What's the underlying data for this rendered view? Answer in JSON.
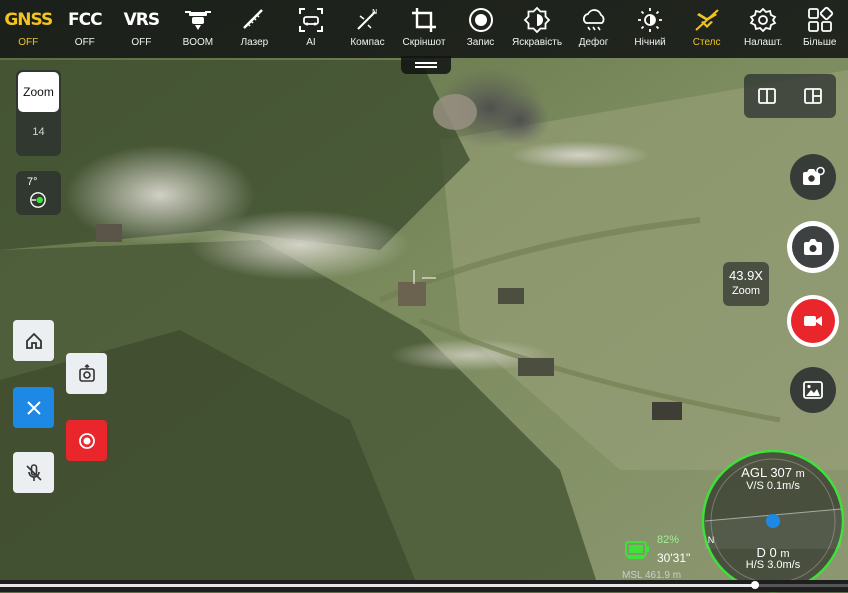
{
  "toolbar": {
    "items": [
      {
        "id": "gnss",
        "label": "OFF",
        "big": "GNSS",
        "icon": "gnss-icon",
        "active": true
      },
      {
        "id": "fcc",
        "label": "OFF",
        "big": "FCC",
        "icon": "fcc-icon",
        "active": false
      },
      {
        "id": "vrs",
        "label": "OFF",
        "big": "VRS",
        "icon": "vrs-icon",
        "active": false
      },
      {
        "id": "boom",
        "label": "BOOM",
        "icon": "drone-icon",
        "active": false
      },
      {
        "id": "laser",
        "label": "Лазер",
        "icon": "ruler-icon",
        "active": false
      },
      {
        "id": "ai",
        "label": "AI",
        "icon": "ai-icon",
        "active": false
      },
      {
        "id": "compass",
        "label": "Компас",
        "icon": "compass-icon",
        "active": false
      },
      {
        "id": "screenshot",
        "label": "Скріншот",
        "icon": "crop-icon",
        "active": false
      },
      {
        "id": "record",
        "label": "Запис",
        "icon": "record-icon",
        "active": false
      },
      {
        "id": "brightness",
        "label": "Яскравість",
        "icon": "brightness-icon",
        "active": false
      },
      {
        "id": "defog",
        "label": "Дефог",
        "icon": "defog-icon",
        "active": false
      },
      {
        "id": "night",
        "label": "Нічний",
        "icon": "sun-icon",
        "active": false
      },
      {
        "id": "stealth",
        "label": "Стелс",
        "icon": "stealth-icon",
        "active": true
      },
      {
        "id": "settings",
        "label": "Налашт.",
        "icon": "gear-icon",
        "active": false
      },
      {
        "id": "more",
        "label": "Більше",
        "icon": "grid-icon",
        "active": false
      }
    ]
  },
  "left_panel": {
    "zoom_label": "Zoom",
    "zoom_value": "14",
    "gimbal_angle": "7°"
  },
  "right_panel": {
    "zoom_overlay_value": "43.9X",
    "zoom_overlay_label": "Zoom"
  },
  "status": {
    "battery_percent": "82%",
    "flight_time": "30'31\"",
    "msl": "MSL 461.9 m"
  },
  "radar": {
    "agl_label": "AGL",
    "agl_value": "307",
    "agl_unit": "m",
    "vs": "V/S 0.1m/s",
    "d_label": "D",
    "d_value": "0",
    "d_unit": "m",
    "hs": "H/S 3.0m/s",
    "n_label": "N"
  },
  "playback": {
    "progress": 0.89
  },
  "colors": {
    "accent": "#f3c322",
    "record_red": "#e8262b",
    "blue_button": "#1e88e5",
    "radar_green": "#3fe03a"
  }
}
